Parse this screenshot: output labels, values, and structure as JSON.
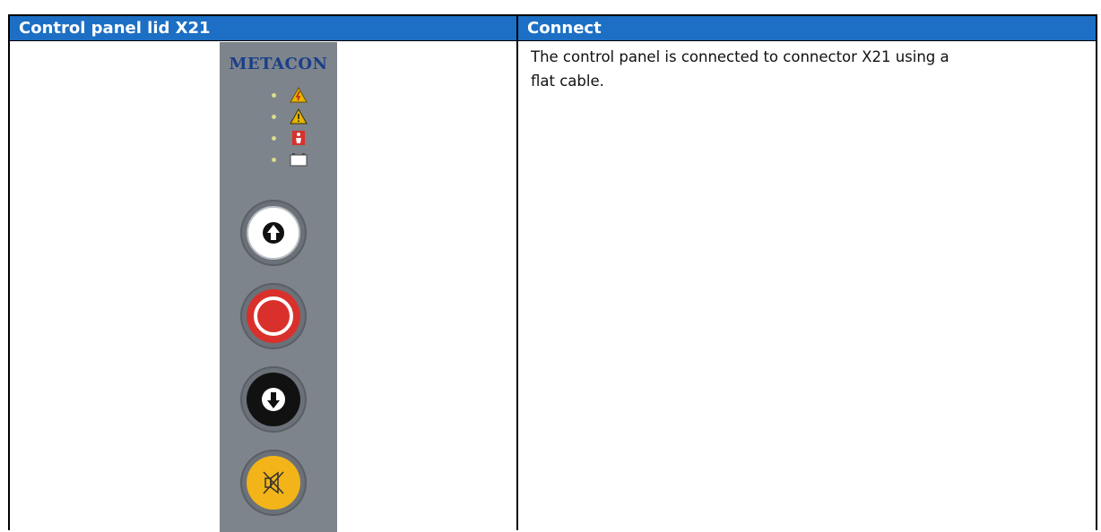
{
  "table": {
    "left_header": "Control panel lid X21",
    "right_header": "Connect",
    "description_line1": "The control panel is connected to connector X21 using a",
    "description_line2": "flat cable."
  },
  "panel": {
    "logo_text": "METACON",
    "indicators": [
      {
        "icon": "lightning-warning-icon",
        "color": "#e8b400"
      },
      {
        "icon": "warning-triangle-icon",
        "color": "#e8b400"
      },
      {
        "icon": "emergency-person-icon",
        "color": "#d9302c"
      },
      {
        "icon": "battery-icon",
        "color": "#ffffff"
      }
    ],
    "buttons": [
      {
        "name": "up-button",
        "icon": "arrow-up-icon",
        "face_color": "#ffffff"
      },
      {
        "name": "stop-button",
        "icon": "stop-circle-icon",
        "face_color": "#d9302c"
      },
      {
        "name": "down-button",
        "icon": "arrow-down-icon",
        "face_color": "#111111"
      },
      {
        "name": "alarm-mute-button",
        "icon": "speaker-muted-icon",
        "face_color": "#f2b418"
      }
    ]
  },
  "colors": {
    "header_bg": "#1c6fc4",
    "panel_bg": "#7d848c",
    "logo": "#1b3f8a"
  }
}
